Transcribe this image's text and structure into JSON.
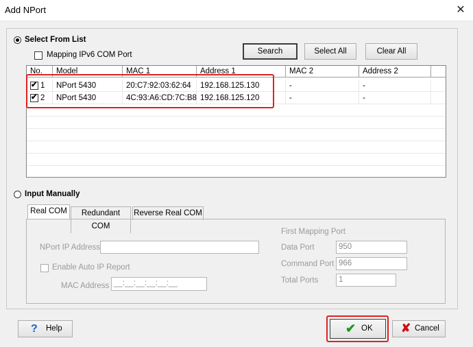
{
  "window": {
    "title": "Add NPort",
    "close_icon": "close-icon"
  },
  "select_list": {
    "label": "Select From List",
    "mapping_ipv6_label": "Mapping IPv6 COM Port",
    "search": "Search",
    "select_all": "Select All",
    "clear_all": "Clear All",
    "columns": [
      "No.",
      "Model",
      "MAC 1",
      "Address 1",
      "MAC 2",
      "Address 2"
    ],
    "rows": [
      {
        "checked": true,
        "no": "1",
        "model": "NPort 5430",
        "mac1": "20:C7:92:03:62:64",
        "address1": "192.168.125.130",
        "mac2": "-",
        "address2": "-"
      },
      {
        "checked": true,
        "no": "2",
        "model": "NPort 5430",
        "mac1": "4C:93:A6:CD:7C:B8",
        "address1": "192.168.125.120",
        "mac2": "-",
        "address2": "-"
      }
    ]
  },
  "input_manually": {
    "label": "Input Manually",
    "tabs": [
      "Real COM",
      "Redundant COM",
      "Reverse Real COM"
    ],
    "nport_ip_label": "NPort IP Address",
    "auto_ip_label": "Enable Auto IP Report",
    "mac_label": "MAC Address",
    "mac_placeholder": "__:__:__:__:__:__",
    "first_mapping_port_label": "First Mapping Port",
    "data_port_label": "Data Port",
    "data_port_value": "950",
    "command_port_label": "Command Port",
    "command_port_value": "966",
    "total_ports_label": "Total Ports",
    "total_ports_value": "1"
  },
  "footer": {
    "help": "Help",
    "ok": "OK",
    "cancel": "Cancel"
  },
  "colors": {
    "highlight": "#e02020",
    "ok_check": "#1a9a1a",
    "cancel_x": "#cc1111",
    "help_q": "#1f5fbf"
  }
}
